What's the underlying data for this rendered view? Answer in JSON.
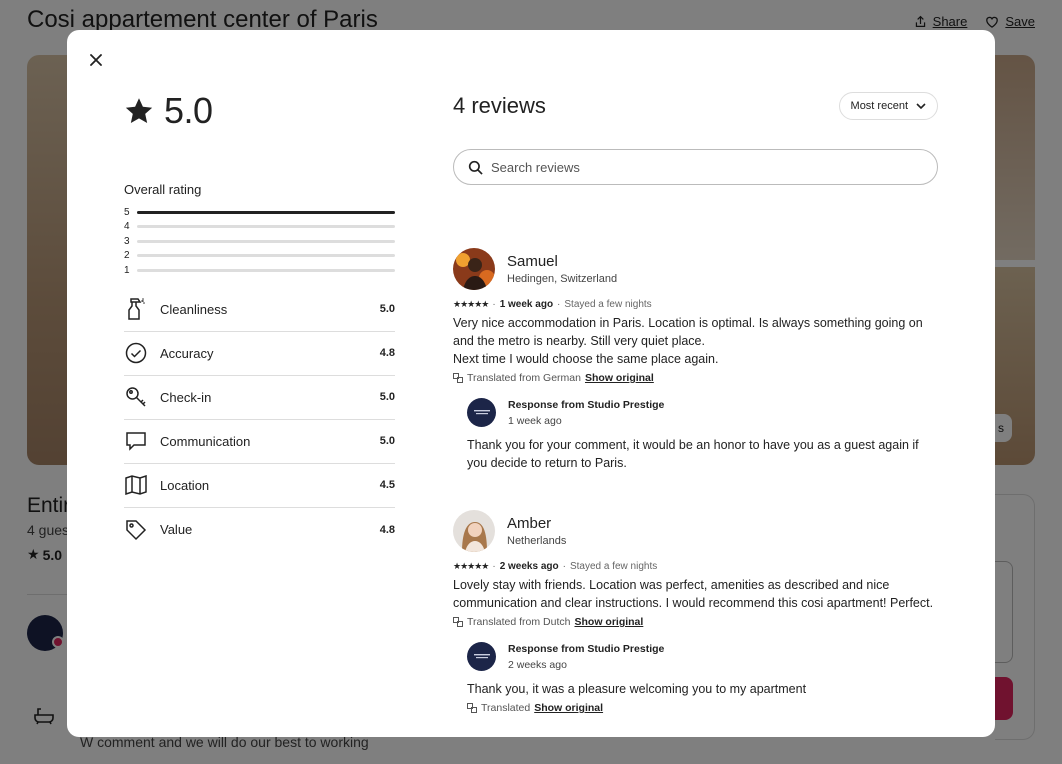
{
  "background": {
    "title": "Cosi appartement center of Paris",
    "share_label": "Share",
    "save_label": "Save",
    "listing_type": "Entir",
    "guests": "4 gues",
    "rating": "5.0",
    "photos_btn": "s",
    "bottom_text": "W comment and we will do our best to working"
  },
  "modal": {
    "overall_score": "5.0",
    "overall_rating_label": "Overall rating",
    "histogram": [
      {
        "label": "5",
        "fraction": 1.0
      },
      {
        "label": "4",
        "fraction": 0
      },
      {
        "label": "3",
        "fraction": 0
      },
      {
        "label": "2",
        "fraction": 0
      },
      {
        "label": "1",
        "fraction": 0
      }
    ],
    "categories": [
      {
        "name": "Cleanliness",
        "score": "5.0",
        "icon": "spray-bottle-icon"
      },
      {
        "name": "Accuracy",
        "score": "4.8",
        "icon": "check-circle-icon"
      },
      {
        "name": "Check-in",
        "score": "5.0",
        "icon": "key-icon"
      },
      {
        "name": "Communication",
        "score": "5.0",
        "icon": "chat-bubble-icon"
      },
      {
        "name": "Location",
        "score": "4.5",
        "icon": "map-icon"
      },
      {
        "name": "Value",
        "score": "4.8",
        "icon": "tag-icon"
      }
    ],
    "reviews_count": "4 reviews",
    "sort_label": "Most recent",
    "search_placeholder": "Search reviews",
    "reviews": [
      {
        "name": "Samuel",
        "location": "Hedingen, Switzerland",
        "stars": "★★★★★",
        "date": "1 week ago",
        "stay": "Stayed a few nights",
        "text": "Very nice accommodation in Paris. Location is optimal. Is always something going on and the metro is nearby. Still very quiet place.\nNext time I would choose the same place again.",
        "translated": "Translated from German",
        "show_original": "Show original",
        "response": {
          "title": "Response from Studio Prestige",
          "date": "1 week ago",
          "text": "Thank you for your comment, it would be an honor to have you as a guest again if you decide to return to Paris."
        }
      },
      {
        "name": "Amber",
        "location": "Netherlands",
        "stars": "★★★★★",
        "date": "2 weeks ago",
        "stay": "Stayed a few nights",
        "text": "Lovely stay with friends. Location was perfect, amenities as described and nice communication and clear instructions. I would recommend this cosi apartment! Perfect.",
        "translated": "Translated from Dutch",
        "show_original": "Show original",
        "response": {
          "title": "Response from Studio Prestige",
          "date": "2 weeks ago",
          "text": "Thank you, it was a pleasure welcoming you to my apartment",
          "translated": "Translated",
          "show_original": "Show original"
        }
      }
    ]
  }
}
